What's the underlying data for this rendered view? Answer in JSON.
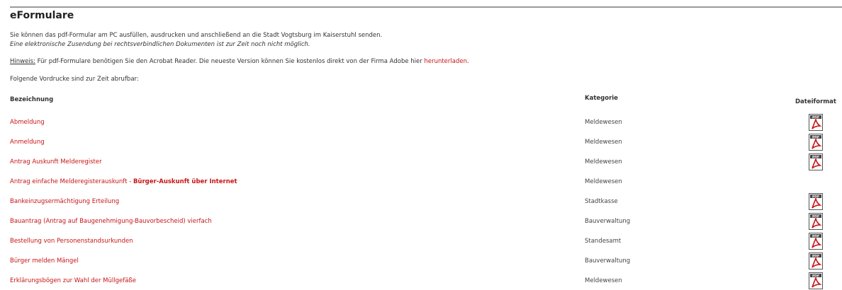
{
  "page": {
    "title": "eFormulare",
    "intro_line1": "Sie können das pdf-Formular am PC ausfüllen, ausdrucken und anschließend an die Stadt Vogtsburg im Kaiserstuhl senden.",
    "intro_line2": "Eine elektronische Zusendung bei rechtsverbindlichen Dokumenten ist zur Zeit noch nicht möglich.",
    "hint_label": "Hinweis:",
    "hint_text": " Für pdf-Formulare benötigen Sie den Acrobat Reader. Die neueste Version können Sie kostenlos direkt von der Firma Adobe hier ",
    "hint_link": "herunterladen",
    "hint_end": ".",
    "available_text": "Folgende Vordrucke sind zur Zeit abrufbar:"
  },
  "table": {
    "headers": {
      "name": "Bezeichnung",
      "category": "Kategorie",
      "format": "Dateiformat"
    },
    "rows": [
      {
        "name": "Abmeldung",
        "name_bold": "",
        "category": "Meldewesen",
        "pdf": true
      },
      {
        "name": "Anmeldung",
        "name_bold": "",
        "category": "Meldewesen",
        "pdf": true
      },
      {
        "name": "Antrag Auskunft Melderegister",
        "name_bold": "",
        "category": "Meldewesen",
        "pdf": true
      },
      {
        "name": "Antrag einfache Melderegisterauskunft - ",
        "name_bold": "Bürger-Auskunft über Internet",
        "category": "Meldewesen",
        "pdf": false
      },
      {
        "name": "Bankeinzugsermächtigung Erteilung",
        "name_bold": "",
        "category": "Stadtkasse",
        "pdf": true
      },
      {
        "name": "Bauantrag (Antrag auf Baugenehmigung-Bauvorbescheid) vierfach",
        "name_bold": "",
        "category": "Bauverwaltung",
        "pdf": true
      },
      {
        "name": "Bestellung von Personenstandsurkunden",
        "name_bold": "",
        "category": "Standesamt",
        "pdf": true
      },
      {
        "name": "Bürger melden Mängel",
        "name_bold": "",
        "category": "Bauverwaltung",
        "pdf": true
      },
      {
        "name": "Erklärungsbögen zur Wahl der Müllgefäße",
        "name_bold": "",
        "category": "Meldewesen",
        "pdf": true
      }
    ]
  },
  "icons": {
    "pdf_icon": "pdf-file-icon"
  },
  "colors": {
    "link": "#c81414",
    "text": "#333333",
    "rule": "#9a9a9a"
  }
}
